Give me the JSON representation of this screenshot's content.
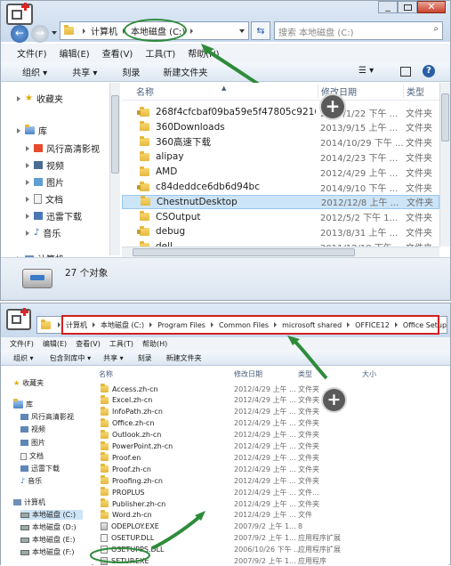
{
  "top": {
    "breadcrumb": [
      "计算机",
      "本地磁盘 (C:)"
    ],
    "search_placeholder": "搜索 本地磁盘 (C:)",
    "menu": [
      "文件(F)",
      "编辑(E)",
      "查看(V)",
      "工具(T)",
      "帮助(H)"
    ],
    "toolbar": {
      "organize": "组织",
      "share": "共享",
      "burn": "刻录",
      "new_folder": "新建文件夹"
    },
    "nav": [
      {
        "label": "收藏夹",
        "icon": "star-icon"
      },
      {
        "label": "库",
        "icon": "library-icon"
      },
      {
        "label": "风行高清影视",
        "icon": "video-app-icon"
      },
      {
        "label": "视频",
        "icon": "video-icon"
      },
      {
        "label": "图片",
        "icon": "picture-icon"
      },
      {
        "label": "文档",
        "icon": "document-icon"
      },
      {
        "label": "迅雷下载",
        "icon": "thunder-icon"
      },
      {
        "label": "音乐",
        "icon": "music-icon"
      },
      {
        "label": "计算机",
        "icon": "computer-icon"
      }
    ],
    "columns": {
      "name": "名称",
      "date": "修改日期",
      "type": "类型"
    },
    "files": [
      {
        "name": "268f4cfcbaf09ba59e5f47805c9216",
        "date": "2014/1/22 下午 ...",
        "type": "文件夹"
      },
      {
        "name": "360Downloads",
        "date": "2013/9/15 上午 ...",
        "type": "文件夹"
      },
      {
        "name": "360高速下载",
        "date": "2014/10/29 下午 ...",
        "type": "文件夹"
      },
      {
        "name": "alipay",
        "date": "2014/2/23 下午 ...",
        "type": "文件夹"
      },
      {
        "name": "AMD",
        "date": "2012/4/29 上午 ...",
        "type": "文件夹"
      },
      {
        "name": "c84deddce6db6d94bc",
        "date": "2014/9/10 下午 ...",
        "type": "文件夹"
      },
      {
        "name": "ChestnutDesktop",
        "date": "2012/12/8 上午 ...",
        "type": "文件夹"
      },
      {
        "name": "CSOutput",
        "date": "2012/5/2 下午 1...",
        "type": "文件夹"
      },
      {
        "name": "debug",
        "date": "2013/8/31 上午 ...",
        "type": "文件夹"
      },
      {
        "name": "dell",
        "date": "2011/12/18 下午 ...",
        "type": "文件夹"
      }
    ],
    "status": "27 个对象"
  },
  "bottom": {
    "breadcrumb": [
      "计算机",
      "本地磁盘 (C:)",
      "Program Files",
      "Common Files",
      "microsoft shared",
      "OFFICE12",
      "Office Setup Controller"
    ],
    "menu": [
      "文件(F)",
      "编辑(E)",
      "查看(V)",
      "工具(T)",
      "帮助(H)"
    ],
    "toolbar": {
      "organize": "组织",
      "include": "包含到库中",
      "share": "共享",
      "burn": "刻录",
      "new_folder": "新建文件夹"
    },
    "nav": [
      {
        "label": "收藏夹",
        "icon": "star-icon"
      },
      {
        "label": "库",
        "icon": "library-icon"
      },
      {
        "label": "风行高清影视",
        "icon": "video-app-icon"
      },
      {
        "label": "视频",
        "icon": "video-icon"
      },
      {
        "label": "图片",
        "icon": "picture-icon"
      },
      {
        "label": "文档",
        "icon": "document-icon"
      },
      {
        "label": "迅雷下载",
        "icon": "thunder-icon"
      },
      {
        "label": "音乐",
        "icon": "music-icon"
      },
      {
        "label": "计算机",
        "icon": "computer-icon"
      },
      {
        "label": "本地磁盘 (C:)",
        "icon": "drive-icon"
      },
      {
        "label": "本地磁盘 (D:)",
        "icon": "drive-icon"
      },
      {
        "label": "本地磁盘 (E:)",
        "icon": "drive-icon"
      },
      {
        "label": "本地磁盘 (F:)",
        "icon": "drive-icon"
      }
    ],
    "columns": {
      "name": "名称",
      "date": "修改日期",
      "type": "类型",
      "size": "大小"
    },
    "files": [
      {
        "name": "Access.zh-cn",
        "date": "2012/4/29 上午 ...",
        "type": "文件夹",
        "kind": "folder"
      },
      {
        "name": "Excel.zh-cn",
        "date": "2012/4/29 上午 ...",
        "type": "文件夹",
        "kind": "folder"
      },
      {
        "name": "InfoPath.zh-cn",
        "date": "2012/4/29 上午 ...",
        "type": "文件夹",
        "kind": "folder"
      },
      {
        "name": "Office.zh-cn",
        "date": "2012/4/29 上午 ...",
        "type": "文件夹",
        "kind": "folder"
      },
      {
        "name": "Outlook.zh-cn",
        "date": "2012/4/29 上午 ...",
        "type": "文件夹",
        "kind": "folder"
      },
      {
        "name": "PowerPoint.zh-cn",
        "date": "2012/4/29 上午 ...",
        "type": "文件夹",
        "kind": "folder"
      },
      {
        "name": "Proof.en",
        "date": "2012/4/29 上午 ...",
        "type": "文件夹",
        "kind": "folder"
      },
      {
        "name": "Proof.zh-cn",
        "date": "2012/4/29 上午 ...",
        "type": "文件夹",
        "kind": "folder"
      },
      {
        "name": "Proofing.zh-cn",
        "date": "2012/4/29 上午 ...",
        "type": "文件夹",
        "kind": "folder"
      },
      {
        "name": "PROPLUS",
        "date": "2012/4/29 上午 ...",
        "type": "文件...",
        "kind": "folder"
      },
      {
        "name": "Publisher.zh-cn",
        "date": "2012/4/29 上午 ...",
        "type": "文件夹",
        "kind": "folder"
      },
      {
        "name": "Word.zh-cn",
        "date": "2012/4/29 上午 ...",
        "type": "文件",
        "kind": "folder"
      },
      {
        "name": "ODEPLOY.EXE",
        "date": "2007/9/2 上午 1...",
        "type": "8",
        "kind": "exe"
      },
      {
        "name": "OSETUP.DLL",
        "date": "2007/9/2 上午 1...",
        "type": "应用程序扩展",
        "kind": "file"
      },
      {
        "name": "OSETUPPS.DLL",
        "date": "2006/10/26 下午 ...",
        "type": "应用程序扩展",
        "kind": "file"
      },
      {
        "name": "SETUP.EXE",
        "date": "2007/9/2 上午 1...",
        "type": "应用程序",
        "kind": "exe"
      }
    ]
  },
  "colors": {
    "highlight_green": "#2e8b3a",
    "red_box": "#d42020",
    "selection": "#cce4f7"
  }
}
